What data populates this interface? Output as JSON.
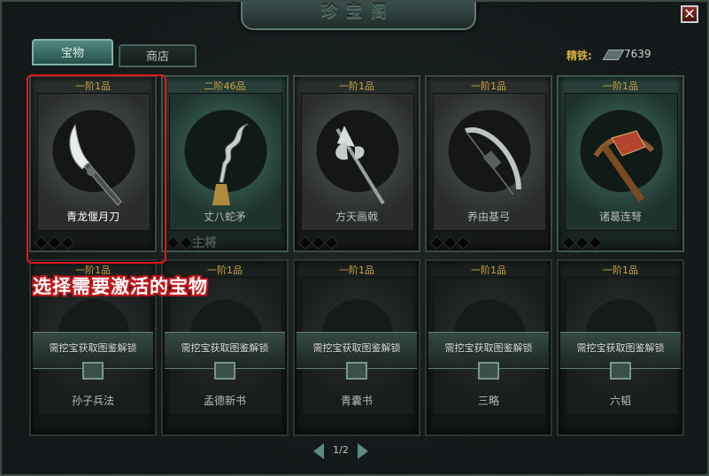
{
  "window": {
    "title": "珍宝阁",
    "close_glyph": "✕"
  },
  "tabs": [
    {
      "label": "宝物",
      "active": true
    },
    {
      "label": "商店",
      "active": false
    }
  ],
  "resource": {
    "label": "精铁:",
    "icon": "iron-ingot-icon",
    "value": "7639"
  },
  "cards_row1": [
    {
      "grade": "一阶1品",
      "name": "青龙偃月刀",
      "weapon": "blade-icon",
      "selected": true
    },
    {
      "grade": "二阶46品",
      "name": "丈八蛇矛",
      "weapon": "serpent-spear-icon",
      "selected": false
    },
    {
      "grade": "一阶1品",
      "name": "方天画戟",
      "weapon": "halberd-icon",
      "selected": false
    },
    {
      "grade": "一阶1品",
      "name": "养由基弓",
      "weapon": "bow-icon",
      "selected": false
    },
    {
      "grade": "一阶1品",
      "name": "诸葛连弩",
      "weapon": "crossbow-icon",
      "selected": false
    }
  ],
  "cards_row2": [
    {
      "grade": "一阶1品",
      "name": "孙子兵法",
      "lock_text": "需挖宝获取图鉴解锁"
    },
    {
      "grade": "一阶1品",
      "name": "孟德新书",
      "lock_text": "需挖宝获取图鉴解锁"
    },
    {
      "grade": "一阶1品",
      "name": "青囊书",
      "lock_text": "需挖宝获取图鉴解锁"
    },
    {
      "grade": "一阶1品",
      "name": "三略",
      "lock_text": "需挖宝获取图鉴解锁"
    },
    {
      "grade": "一阶1品",
      "name": "六韬",
      "lock_text": "需挖宝获取图鉴解锁"
    }
  ],
  "card_badge": "主将",
  "hint": "选择需要激活的宝物",
  "pager": {
    "label": "1/2"
  },
  "colors": {
    "accent_red": "#e0161a",
    "grade_gold": "#c9a441",
    "tab_active": "#4f8a80"
  }
}
